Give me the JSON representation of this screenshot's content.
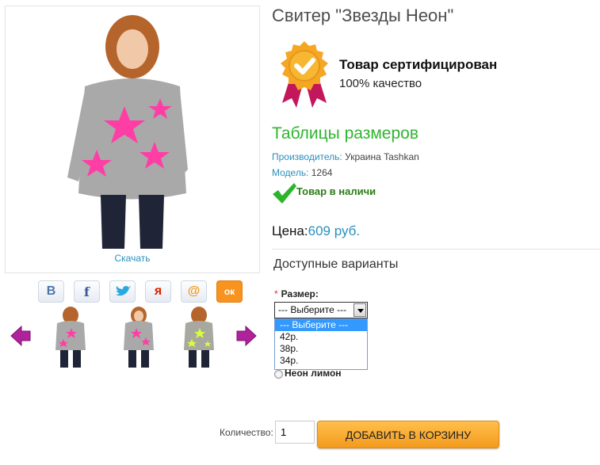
{
  "product": {
    "title": "Свитер \"Звезды Неон\"",
    "download_label": "Скачать"
  },
  "certificate": {
    "title": "Товар сертифицирован",
    "subtitle": "100% качество",
    "icon": "certified-badge-icon"
  },
  "size_tables_label": "Таблицы размеров",
  "manufacturer": {
    "label": "Производитель:",
    "value": "Украина Tashkan"
  },
  "model": {
    "label": "Модель:",
    "value": "1264"
  },
  "stock": {
    "text": "Товар в наличи",
    "icon": "checkmark-icon"
  },
  "price": {
    "label": "Цена:",
    "value": "609 руб."
  },
  "variants": {
    "heading": "Доступные варианты",
    "size_label": "Размер:",
    "required_mark": "*",
    "selected": "--- Выберите ---",
    "options": [
      "--- Выберите ---",
      "42р.",
      "38р.",
      "34р."
    ],
    "color_option": "Неон лимон"
  },
  "social": [
    {
      "name": "vk",
      "icon": "vk-icon",
      "glyph": "В"
    },
    {
      "name": "facebook",
      "icon": "facebook-icon",
      "glyph": "f"
    },
    {
      "name": "twitter",
      "icon": "twitter-icon",
      "glyph": ""
    },
    {
      "name": "yaru",
      "icon": "yaru-icon",
      "glyph": "я"
    },
    {
      "name": "mailru",
      "icon": "mailru-icon",
      "glyph": "@"
    },
    {
      "name": "odnoklassniki",
      "icon": "odnoklassniki-icon",
      "glyph": "ок"
    }
  ],
  "cart": {
    "qty_label": "Количество:",
    "qty_value": "1",
    "add_button": "ДОБАВИТЬ В КОРЗИНУ"
  },
  "colors": {
    "accent_green": "#2fb52f",
    "link_blue": "#2a8fbd",
    "button_orange": "#f7a52c",
    "sweater_grey": "#a9a9a9",
    "star_pink": "#ff3ea5",
    "star_lime": "#d8ff3a"
  }
}
